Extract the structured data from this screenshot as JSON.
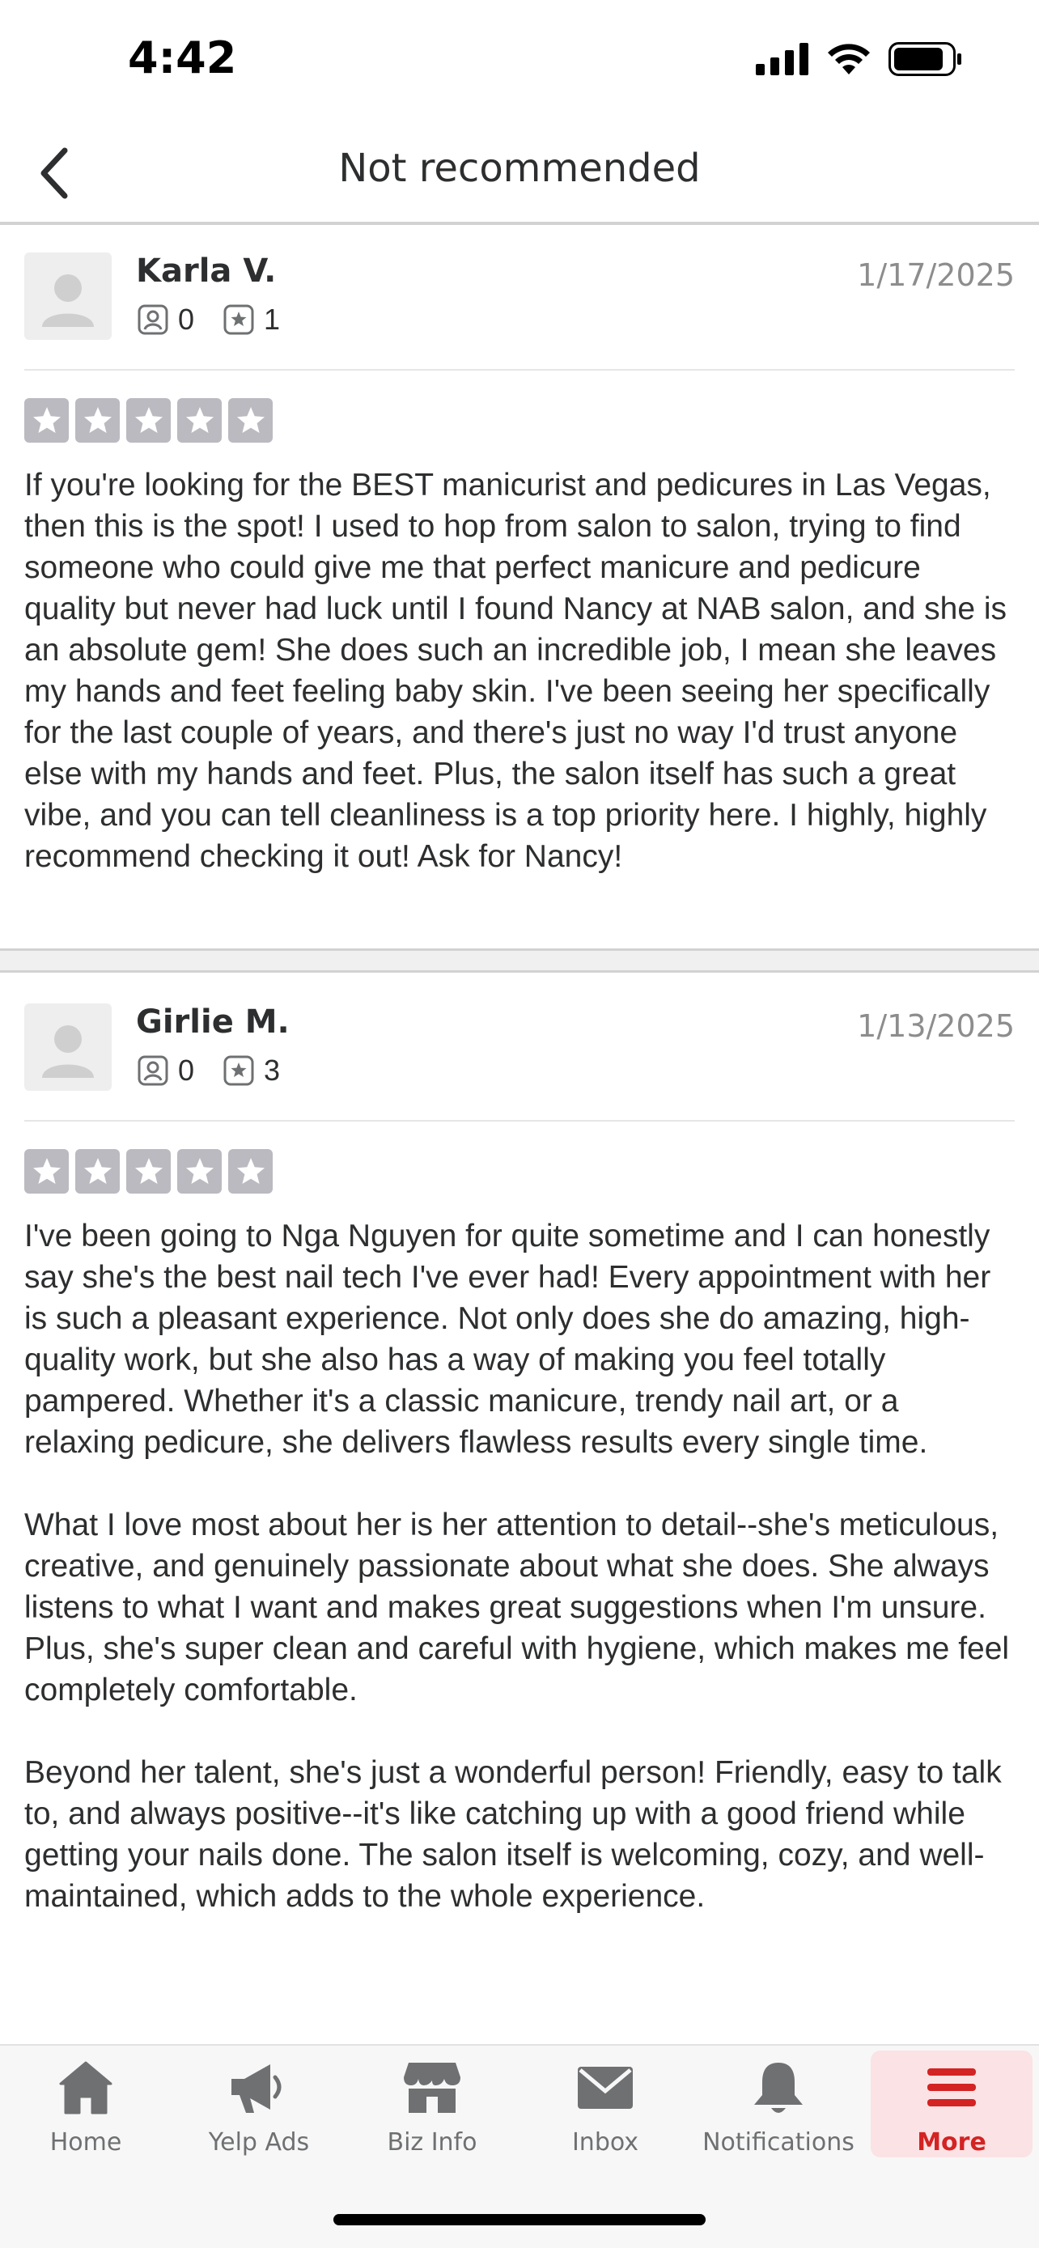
{
  "status_bar": {
    "time": "4:42"
  },
  "header": {
    "title": "Not recommended"
  },
  "reviews": [
    {
      "user": "Karla V.",
      "friends": "0",
      "review_count": "1",
      "date": "1/17/2025",
      "rating": 5,
      "paragraphs": [
        "If you're looking for the BEST manicurist and pedicures in Las Vegas, then this is the spot! I used to hop from salon to salon, trying to find someone who could give me that perfect manicure and pedicure quality but never had luck until I found Nancy at NAB salon, and she is an absolute gem! She does such an incredible job, I mean she leaves my hands and feet feeling baby skin. I've been seeing her specifically for the last couple of years, and there's just no way I'd trust anyone else with my hands and feet. Plus, the salon itself has such a great vibe, and you can tell cleanliness is a top priority here. I highly, highly recommend checking it out! Ask for Nancy!"
      ]
    },
    {
      "user": "Girlie M.",
      "friends": "0",
      "review_count": "3",
      "date": "1/13/2025",
      "rating": 5,
      "paragraphs": [
        "I've been going to Nga Nguyen for quite sometime and I can honestly say she's the best nail tech I've ever had! Every appointment with her is such a pleasant experience. Not only does she do amazing, high-quality work, but she also has a way of making you feel totally pampered. Whether it's a classic manicure, trendy nail art, or a relaxing pedicure, she delivers flawless results every single time.",
        "What I love most about her is her attention to detail--she's meticulous, creative, and genuinely passionate about what she does. She always listens to what I want and makes great suggestions when I'm unsure. Plus, she's super clean and careful with hygiene, which makes me feel completely comfortable.",
        "Beyond her talent, she's just a wonderful person! Friendly, easy to talk to, and always positive--it's like catching up with a good friend while getting your nails done. The salon itself is welcoming, cozy, and well-maintained, which adds to the whole experience."
      ]
    }
  ],
  "tab_bar": {
    "tabs": [
      {
        "label": "Home",
        "icon": "home-icon"
      },
      {
        "label": "Yelp Ads",
        "icon": "megaphone-icon"
      },
      {
        "label": "Biz Info",
        "icon": "storefront-icon"
      },
      {
        "label": "Inbox",
        "icon": "envelope-icon"
      },
      {
        "label": "Notifications",
        "icon": "bell-icon"
      },
      {
        "label": "More",
        "icon": "menu-icon"
      }
    ],
    "active": "More"
  },
  "colors": {
    "accent": "#d32323",
    "active_tab_bg": "#fbe2e4",
    "star_gray": "#bbbac0",
    "date_gray": "#8d8d8d"
  }
}
